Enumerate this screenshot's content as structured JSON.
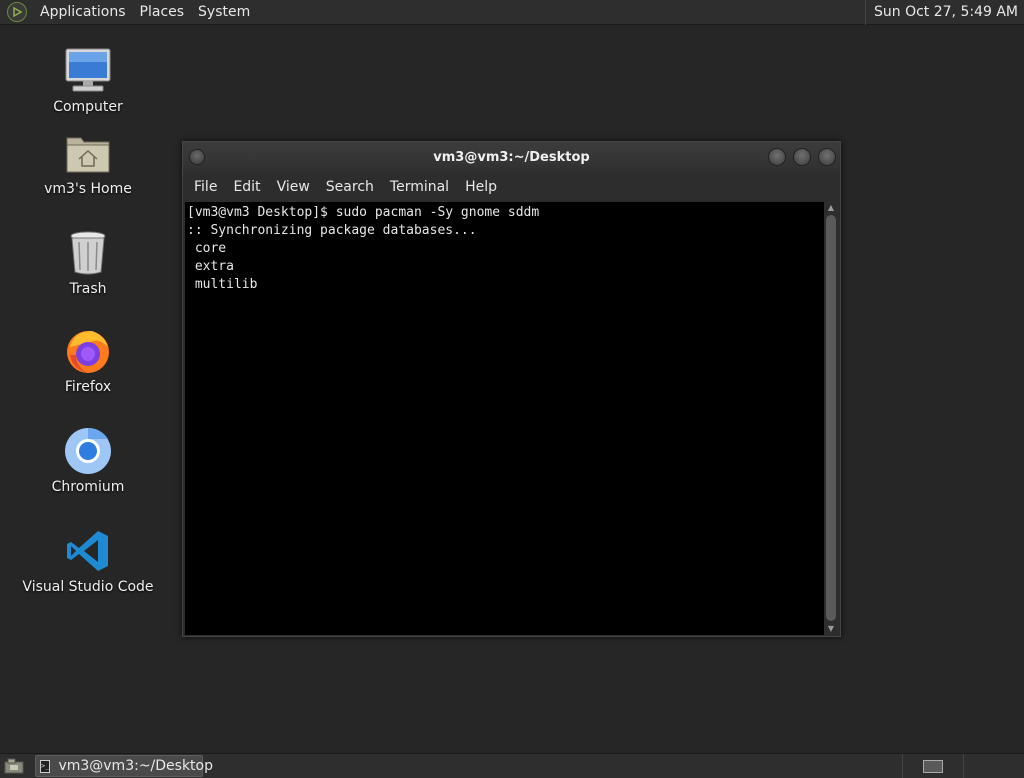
{
  "top_panel": {
    "menus": [
      "Applications",
      "Places",
      "System"
    ],
    "clock": "Sun Oct 27,  5:49 AM"
  },
  "desktop_icons": [
    {
      "label": "Computer",
      "icon": "computer-icon"
    },
    {
      "label": "vm3's Home",
      "icon": "home-folder-icon"
    },
    {
      "label": "Trash",
      "icon": "trash-icon"
    },
    {
      "label": "Firefox",
      "icon": "firefox-icon"
    },
    {
      "label": "Chromium",
      "icon": "chromium-icon"
    },
    {
      "label": "Visual Studio Code",
      "icon": "vscode-icon"
    }
  ],
  "terminal": {
    "title": "vm3@vm3:~/Desktop",
    "menu": [
      "File",
      "Edit",
      "View",
      "Search",
      "Terminal",
      "Help"
    ],
    "output": "[vm3@vm3 Desktop]$ sudo pacman -Sy gnome sddm\n:: Synchronizing package databases...\n core\n extra\n multilib"
  },
  "bottom_panel": {
    "task_label": "vm3@vm3:~/Desktop"
  }
}
